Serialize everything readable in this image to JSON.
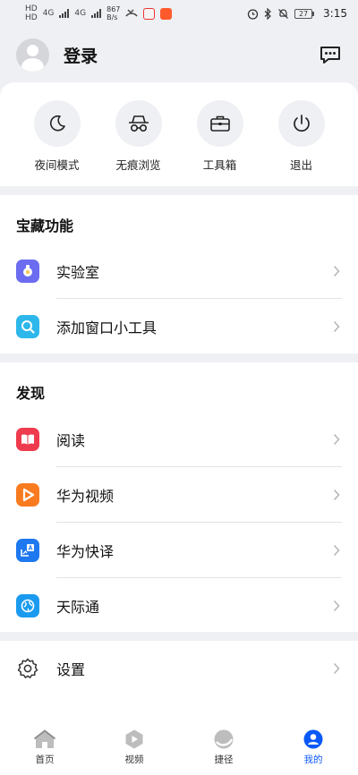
{
  "status_bar": {
    "sim1": "HD",
    "sim2": "HD",
    "net1": "4G",
    "net2": "4G",
    "speed_value": "867",
    "speed_unit": "B/s",
    "battery": "27",
    "time": "3:15"
  },
  "header": {
    "login_label": "登录"
  },
  "quick_actions": [
    {
      "label": "夜间模式",
      "icon": "moon-icon"
    },
    {
      "label": "无痕浏览",
      "icon": "incognito-icon"
    },
    {
      "label": "工具箱",
      "icon": "toolbox-icon"
    },
    {
      "label": "退出",
      "icon": "power-icon"
    }
  ],
  "treasure": {
    "title": "宝藏功能",
    "items": [
      {
        "label": "实验室",
        "icon": "lab-icon",
        "color": "#6b6cf0"
      },
      {
        "label": "添加窗口小工具",
        "icon": "widget-search-icon",
        "color": "#2db7ea"
      }
    ]
  },
  "discover": {
    "title": "发现",
    "items": [
      {
        "label": "阅读",
        "icon": "book-icon",
        "color": "#ee3b4d"
      },
      {
        "label": "华为视频",
        "icon": "video-play-icon",
        "color": "#f97b1f"
      },
      {
        "label": "华为快译",
        "icon": "translate-icon",
        "color": "#1e78f0"
      },
      {
        "label": "天际通",
        "icon": "globe-icon",
        "color": "#1a9bef"
      }
    ]
  },
  "settings": {
    "label": "设置"
  },
  "tabs": [
    {
      "label": "首页",
      "active": false
    },
    {
      "label": "视频",
      "active": false
    },
    {
      "label": "捷径",
      "active": false
    },
    {
      "label": "我的",
      "active": true
    }
  ],
  "colors": {
    "accent": "#0a59f7",
    "background": "#eef0f3"
  }
}
